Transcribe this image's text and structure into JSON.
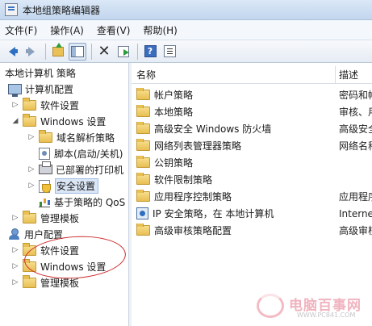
{
  "window": {
    "title": "本地组策略编辑器"
  },
  "menu": [
    "文件(F)",
    "操作(A)",
    "查看(V)",
    "帮助(H)"
  ],
  "toolbar": [
    {
      "name": "back-arrow-icon",
      "cls": "arrow-back"
    },
    {
      "name": "forward-arrow-icon",
      "cls": "arrow-fwd"
    },
    {
      "sep": true
    },
    {
      "name": "up-folder-icon",
      "cls": "icon-up"
    },
    {
      "name": "show-hide-tree-icon",
      "cls": "icon-pane",
      "active": true
    },
    {
      "sep": true
    },
    {
      "name": "delete-icon",
      "cls": "icon-x",
      "glyph": "✕"
    },
    {
      "name": "export-list-icon",
      "cls": "icon-export"
    },
    {
      "sep": true
    },
    {
      "name": "help-icon",
      "cls": "icon-help",
      "glyph": "?"
    },
    {
      "name": "properties-icon",
      "cls": "icon-props"
    }
  ],
  "tree": {
    "root": "本地计算机 策略",
    "items": [
      {
        "label": "计算机配置",
        "level": 0,
        "toggle": "",
        "icon": "computer-icon"
      },
      {
        "label": "软件设置",
        "level": 1,
        "toggle": "▷",
        "icon": "folder"
      },
      {
        "label": "Windows 设置",
        "level": 1,
        "toggle": "◢",
        "icon": "folder"
      },
      {
        "label": "域名解析策略",
        "level": 2,
        "toggle": "▷",
        "icon": "folder"
      },
      {
        "label": "脚本(启动/关机)",
        "level": 2,
        "toggle": "",
        "icon": "script-icon"
      },
      {
        "label": "已部署的打印机",
        "level": 2,
        "toggle": "▷",
        "icon": "printer-icon"
      },
      {
        "label": "安全设置",
        "level": 2,
        "toggle": "▷",
        "icon": "shield-icon",
        "selected": true
      },
      {
        "label": "基于策略的 QoS",
        "level": 2,
        "toggle": "",
        "icon": "chart-icon"
      },
      {
        "label": "管理模板",
        "level": 1,
        "toggle": "▷",
        "icon": "folder"
      },
      {
        "label": "用户配置",
        "level": 0,
        "toggle": "",
        "icon": "user-icon"
      },
      {
        "label": "软件设置",
        "level": 1,
        "toggle": "▷",
        "icon": "folder"
      },
      {
        "label": "Windows 设置",
        "level": 1,
        "toggle": "▷",
        "icon": "folder"
      },
      {
        "label": "管理模板",
        "level": 1,
        "toggle": "▷",
        "icon": "folder"
      }
    ]
  },
  "list": {
    "col_name": "名称",
    "col_desc": "描述",
    "rows": [
      {
        "name": "帐户策略",
        "desc": "密码和帐",
        "icon": "folder"
      },
      {
        "name": "本地策略",
        "desc": "审核、用",
        "icon": "folder"
      },
      {
        "name": "高级安全 Windows 防火墙",
        "desc": "高级安全",
        "icon": "folder"
      },
      {
        "name": "网络列表管理器策略",
        "desc": "网络名称",
        "icon": "folder"
      },
      {
        "name": "公钥策略",
        "desc": "",
        "icon": "folder"
      },
      {
        "name": "软件限制策略",
        "desc": "",
        "icon": "folder"
      },
      {
        "name": "应用程序控制策略",
        "desc": "应用程序",
        "icon": "folder"
      },
      {
        "name": "IP 安全策略，在 本地计算机",
        "desc": "Interne",
        "icon": "net-icon"
      },
      {
        "name": "高级审核策略配置",
        "desc": "高级审核",
        "icon": "folder"
      }
    ]
  },
  "watermark": {
    "title": "电脑百事网",
    "url": "WWW.PC841.COM"
  }
}
